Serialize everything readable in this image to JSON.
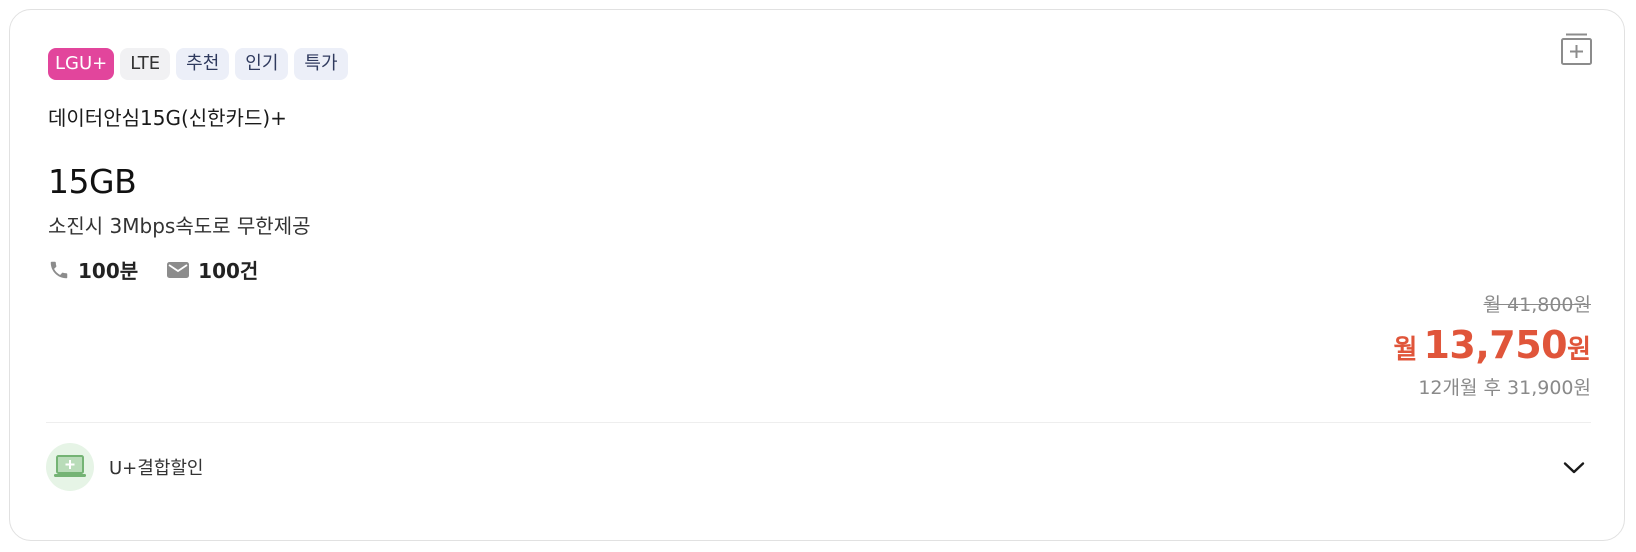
{
  "tags": {
    "carrier": "LGU+",
    "network": "LTE",
    "badges": [
      "추천",
      "인기",
      "특가"
    ]
  },
  "plan": {
    "name": "데이터안심15G(신한카드)+",
    "data_amount": "15GB",
    "data_description": "소진시 3Mbps속도로 무한제공",
    "voice": "100분",
    "sms": "100건"
  },
  "price": {
    "original": "월 41,800원",
    "sale_prefix": "월",
    "sale_amount": "13,750",
    "sale_suffix": "원",
    "after_period": "12개월 후 31,900원"
  },
  "discount": {
    "label": "U+결합할인"
  },
  "icons": {
    "compare": "compare-add-icon",
    "phone": "phone-icon",
    "sms": "mail-icon",
    "discount": "laptop-plus-icon",
    "expand": "chevron-down-icon"
  },
  "colors": {
    "carrier_badge": "#e2459c",
    "sale_price": "#e0553a",
    "discount_icon_bg": "#e6f4e6"
  }
}
